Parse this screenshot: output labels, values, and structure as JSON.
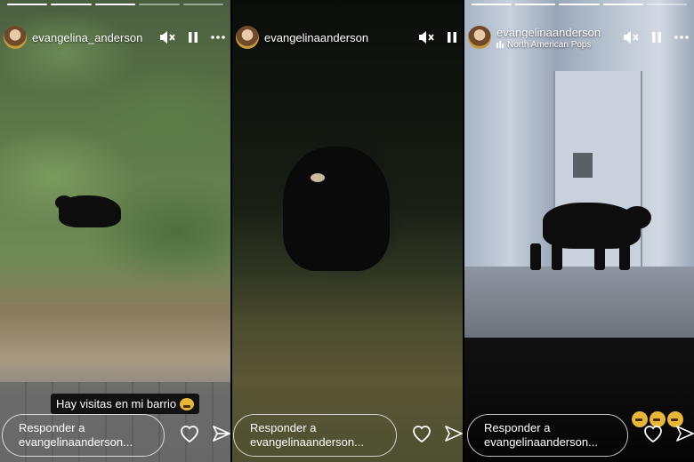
{
  "stories": [
    {
      "username": "evangelina_anderson",
      "caption": "Hay visitas en mi barrio",
      "reply_placeholder": "Responder a evangelinaanderson...",
      "progress_filled": 3,
      "progress_total": 5
    },
    {
      "username": "evangelinaanderson",
      "reply_placeholder": "Responder a evangelinaanderson...",
      "progress_filled": 0,
      "progress_total": 0
    },
    {
      "username": "evangelinaanderson",
      "music": "North American Pops",
      "reply_placeholder": "Responder a evangelinaanderson...",
      "progress_filled": 4,
      "progress_total": 5
    }
  ],
  "icons": {
    "mute": "muted-speaker-icon",
    "pause": "pause-icon",
    "more": "more-dots-icon",
    "like": "heart-icon",
    "send": "send-icon",
    "reaction": "scared-face-emoji"
  },
  "colors": {
    "overlay_text": "#ffffff",
    "caption_bg": "#111111"
  }
}
